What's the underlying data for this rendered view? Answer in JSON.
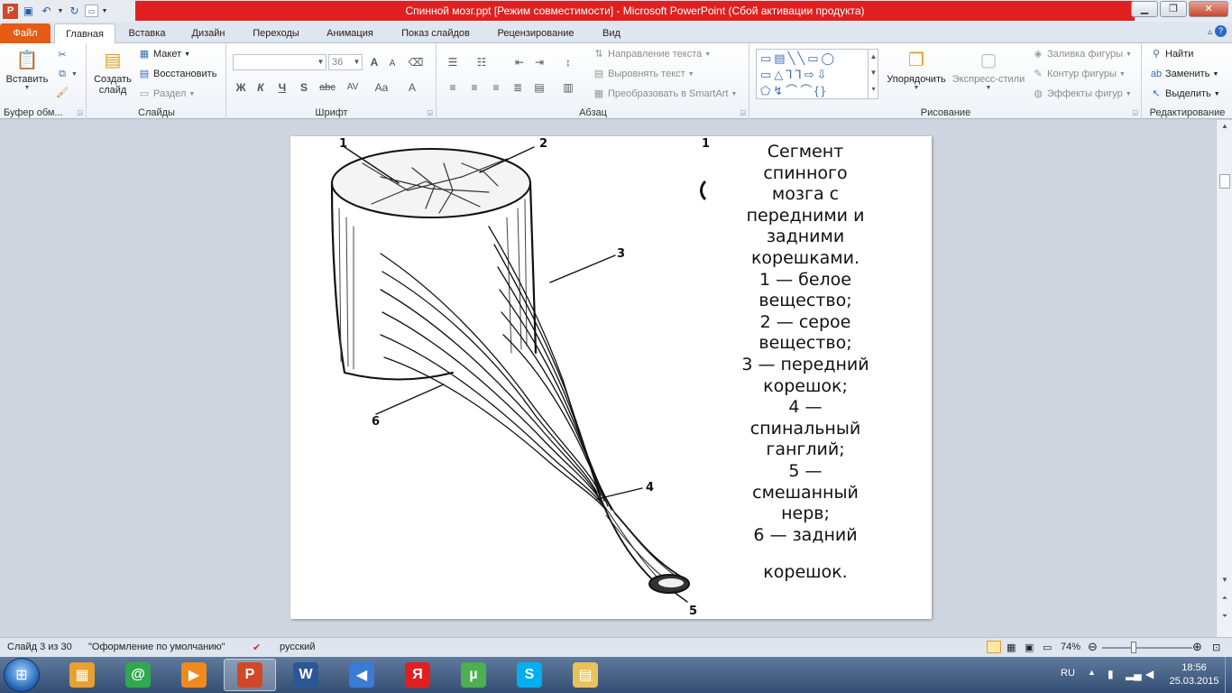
{
  "window": {
    "title": "Спинной мозг.ppt [Режим совместимости]  -  Microsoft PowerPoint (Сбой активации продукта)"
  },
  "tabs": [
    {
      "label": "Файл"
    },
    {
      "label": "Главная"
    },
    {
      "label": "Вставка"
    },
    {
      "label": "Дизайн"
    },
    {
      "label": "Переходы"
    },
    {
      "label": "Анимация"
    },
    {
      "label": "Показ слайдов"
    },
    {
      "label": "Рецензирование"
    },
    {
      "label": "Вид"
    }
  ],
  "ribbon": {
    "clipboard": {
      "paste": "Вставить",
      "group": "Буфер обм..."
    },
    "slides": {
      "new_slide_1": "Создать",
      "new_slide_2": "слайд",
      "layout": "Макет",
      "reset": "Восстановить",
      "section": "Раздел",
      "group": "Слайды"
    },
    "font": {
      "size": "36",
      "bold": "Ж",
      "italic": "К",
      "underline": "Ч",
      "shadow": "S",
      "strike": "abc",
      "spacing": "AV",
      "case": "Aa",
      "color": "A",
      "grow": "A",
      "shrink": "A",
      "group": "Шрифт"
    },
    "paragraph": {
      "text_direction": "Направление текста",
      "align_text": "Выровнять текст",
      "smartart": "Преобразовать в SmartArt",
      "group": "Абзац"
    },
    "drawing": {
      "arrange": "Упорядочить",
      "quick_styles": "Экспресс-стили",
      "fill": "Заливка фигуры",
      "outline": "Контур фигуры",
      "effects": "Эффекты фигур",
      "group": "Рисование"
    },
    "editing": {
      "find": "Найти",
      "replace": "Заменить",
      "select": "Выделить",
      "group": "Редактирование"
    }
  },
  "slide": {
    "figure_labels": {
      "l1_left": "1",
      "l1_right": "1",
      "l2": "2",
      "l3": "3",
      "l4": "4",
      "l5": "5",
      "l6": "6"
    },
    "caption": [
      "Сегмент",
      "спинного",
      "мозга с",
      "передними и",
      "задними",
      "корешками.",
      "1 — белое",
      "вещество;",
      "2 — серое",
      "вещество;",
      "3 — передний",
      "корешок;",
      "4 —",
      "спинальный",
      "ганглий;",
      "5 —",
      "смешанный",
      "нерв;",
      "6 — задний",
      "",
      "корешок."
    ]
  },
  "status": {
    "slide_of": "Слайд 3 из 30",
    "theme": "\"Оформление по умолчанию\"",
    "language": "русский",
    "zoom": "74%"
  },
  "taskbar": {
    "apps": [
      {
        "name": "paint",
        "glyph": "▦"
      },
      {
        "name": "mail-agent",
        "glyph": "@"
      },
      {
        "name": "media-player",
        "glyph": "▶"
      },
      {
        "name": "powerpoint",
        "glyph": "P"
      },
      {
        "name": "word",
        "glyph": "W"
      },
      {
        "name": "sound",
        "glyph": "◀"
      },
      {
        "name": "yandex",
        "glyph": "Я"
      },
      {
        "name": "utorrent",
        "glyph": "µ"
      },
      {
        "name": "skype",
        "glyph": "S"
      },
      {
        "name": "explorer",
        "glyph": "▤"
      }
    ],
    "language": "RU",
    "time": "18:56",
    "date": "25.03.2015"
  }
}
